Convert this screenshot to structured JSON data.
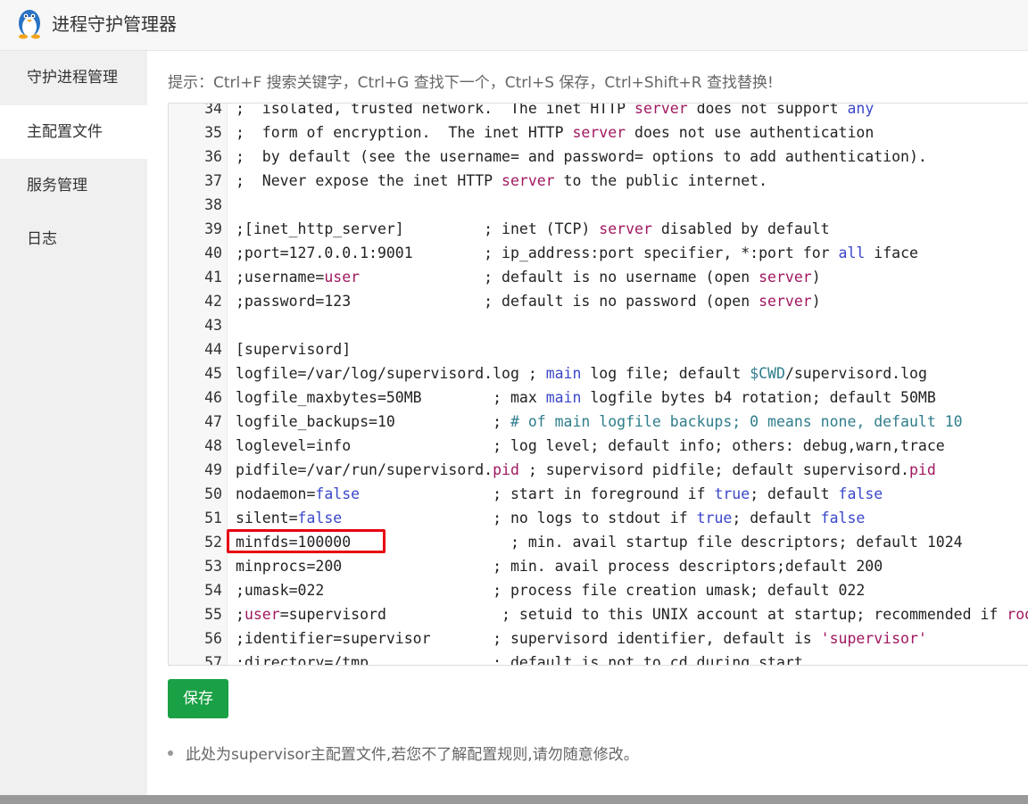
{
  "app": {
    "title": "进程守护管理器"
  },
  "sidebar": {
    "items": [
      {
        "label": "守护进程管理",
        "active": false
      },
      {
        "label": "主配置文件",
        "active": true
      },
      {
        "label": "服务管理",
        "active": false
      },
      {
        "label": "日志",
        "active": false
      }
    ]
  },
  "hint": "提示：Ctrl+F 搜索关键字，Ctrl+G 查找下一个，Ctrl+S 保存，Ctrl+Shift+R 查找替换!",
  "editor": {
    "lines": [
      {
        "n": "34",
        "t": [
          [
            "",
            ";  isolated, trusted network.  The inet HTTP "
          ],
          [
            "kw",
            "server"
          ],
          [
            "",
            " does not support "
          ],
          [
            "fn",
            "any"
          ]
        ]
      },
      {
        "n": "35",
        "t": [
          [
            "",
            ";  form of encryption.  The inet HTTP "
          ],
          [
            "kw",
            "server"
          ],
          [
            "",
            " does not use authentication"
          ]
        ]
      },
      {
        "n": "36",
        "t": [
          [
            "",
            ";  by default (see the username= and password= options to add authentication)."
          ]
        ]
      },
      {
        "n": "37",
        "t": [
          [
            "",
            ";  Never expose the inet HTTP "
          ],
          [
            "kw",
            "server"
          ],
          [
            "",
            " to the public internet."
          ]
        ]
      },
      {
        "n": "38",
        "t": [
          [
            "",
            ""
          ]
        ]
      },
      {
        "n": "39",
        "t": [
          [
            "",
            ";[inet_http_server]         ; inet (TCP) "
          ],
          [
            "kw",
            "server"
          ],
          [
            "",
            " disabled by default"
          ]
        ]
      },
      {
        "n": "40",
        "t": [
          [
            "",
            ";port=127.0.0.1:9001        ; ip_address:port specifier, *:port for "
          ],
          [
            "fn",
            "all"
          ],
          [
            "",
            " iface"
          ]
        ]
      },
      {
        "n": "41",
        "t": [
          [
            "",
            ";username="
          ],
          [
            "kw",
            "user"
          ],
          [
            "",
            "              ; default is no username (open "
          ],
          [
            "kw",
            "server"
          ],
          [
            "",
            ")"
          ]
        ]
      },
      {
        "n": "42",
        "t": [
          [
            "",
            ";password=123               ; default is no password (open "
          ],
          [
            "kw",
            "server"
          ],
          [
            "",
            ")"
          ]
        ]
      },
      {
        "n": "43",
        "t": [
          [
            "",
            ""
          ]
        ]
      },
      {
        "n": "44",
        "t": [
          [
            "",
            "[supervisord]"
          ]
        ]
      },
      {
        "n": "45",
        "t": [
          [
            "",
            "logfile=/var/log/supervisord.log ; "
          ],
          [
            "fn",
            "main"
          ],
          [
            "",
            " log file; default "
          ],
          [
            "cm",
            "$CWD"
          ],
          [
            "",
            "/supervisord.log"
          ]
        ]
      },
      {
        "n": "46",
        "t": [
          [
            "",
            "logfile_maxbytes=50MB        ; max "
          ],
          [
            "fn",
            "main"
          ],
          [
            "",
            " logfile bytes b4 rotation; default 50MB"
          ]
        ]
      },
      {
        "n": "47",
        "t": [
          [
            "",
            "logfile_backups=10           ; "
          ],
          [
            "cm",
            "# of main logfile backups; 0 means none, default 10"
          ]
        ]
      },
      {
        "n": "48",
        "t": [
          [
            "",
            "loglevel=info                ; log level; default info; others: debug,warn,trace"
          ]
        ]
      },
      {
        "n": "49",
        "t": [
          [
            "",
            "pidfile=/var/run/supervisord."
          ],
          [
            "kw",
            "pid"
          ],
          [
            "",
            " ; supervisord pidfile; default supervisord."
          ],
          [
            "kw",
            "pid"
          ]
        ]
      },
      {
        "n": "50",
        "t": [
          [
            "",
            "nodaemon="
          ],
          [
            "fn",
            "false"
          ],
          [
            "",
            "               ; start in foreground if "
          ],
          [
            "fn",
            "true"
          ],
          [
            "",
            "; default "
          ],
          [
            "fn",
            "false"
          ]
        ]
      },
      {
        "n": "51",
        "t": [
          [
            "",
            "silent="
          ],
          [
            "fn",
            "false"
          ],
          [
            "",
            "                 ; no logs to stdout if "
          ],
          [
            "fn",
            "true"
          ],
          [
            "",
            "; default "
          ],
          [
            "fn",
            "false"
          ]
        ]
      },
      {
        "n": "52",
        "t": [
          [
            "",
            "minfds=100000                  ; min. avail startup file descriptors; default 1024"
          ]
        ]
      },
      {
        "n": "53",
        "t": [
          [
            "",
            "minprocs=200                 ; min. avail process descriptors;default 200"
          ]
        ]
      },
      {
        "n": "54",
        "t": [
          [
            "",
            ";umask=022                   ; process file creation umask; default 022"
          ]
        ]
      },
      {
        "n": "55",
        "t": [
          [
            "",
            ";"
          ],
          [
            "kw",
            "user"
          ],
          [
            "",
            "=supervisord             ; setuid to this UNIX account at startup; recommended if "
          ],
          [
            "kw",
            "root"
          ]
        ]
      },
      {
        "n": "56",
        "t": [
          [
            "",
            ";identifier=supervisor       ; supervisord identifier, default is "
          ],
          [
            "str",
            "'supervisor'"
          ]
        ]
      },
      {
        "n": "57",
        "t": [
          [
            "",
            ";directory=/tmp              ; default is not to cd during start"
          ]
        ]
      }
    ]
  },
  "buttons": {
    "save_label": "保存"
  },
  "note": "此处为supervisor主配置文件,若您不了解配置规则,请勿随意修改。",
  "colors": {
    "save_button": "#1aa045",
    "highlight_box": "#e60012"
  },
  "icons": {
    "logo": "penguin-icon"
  }
}
